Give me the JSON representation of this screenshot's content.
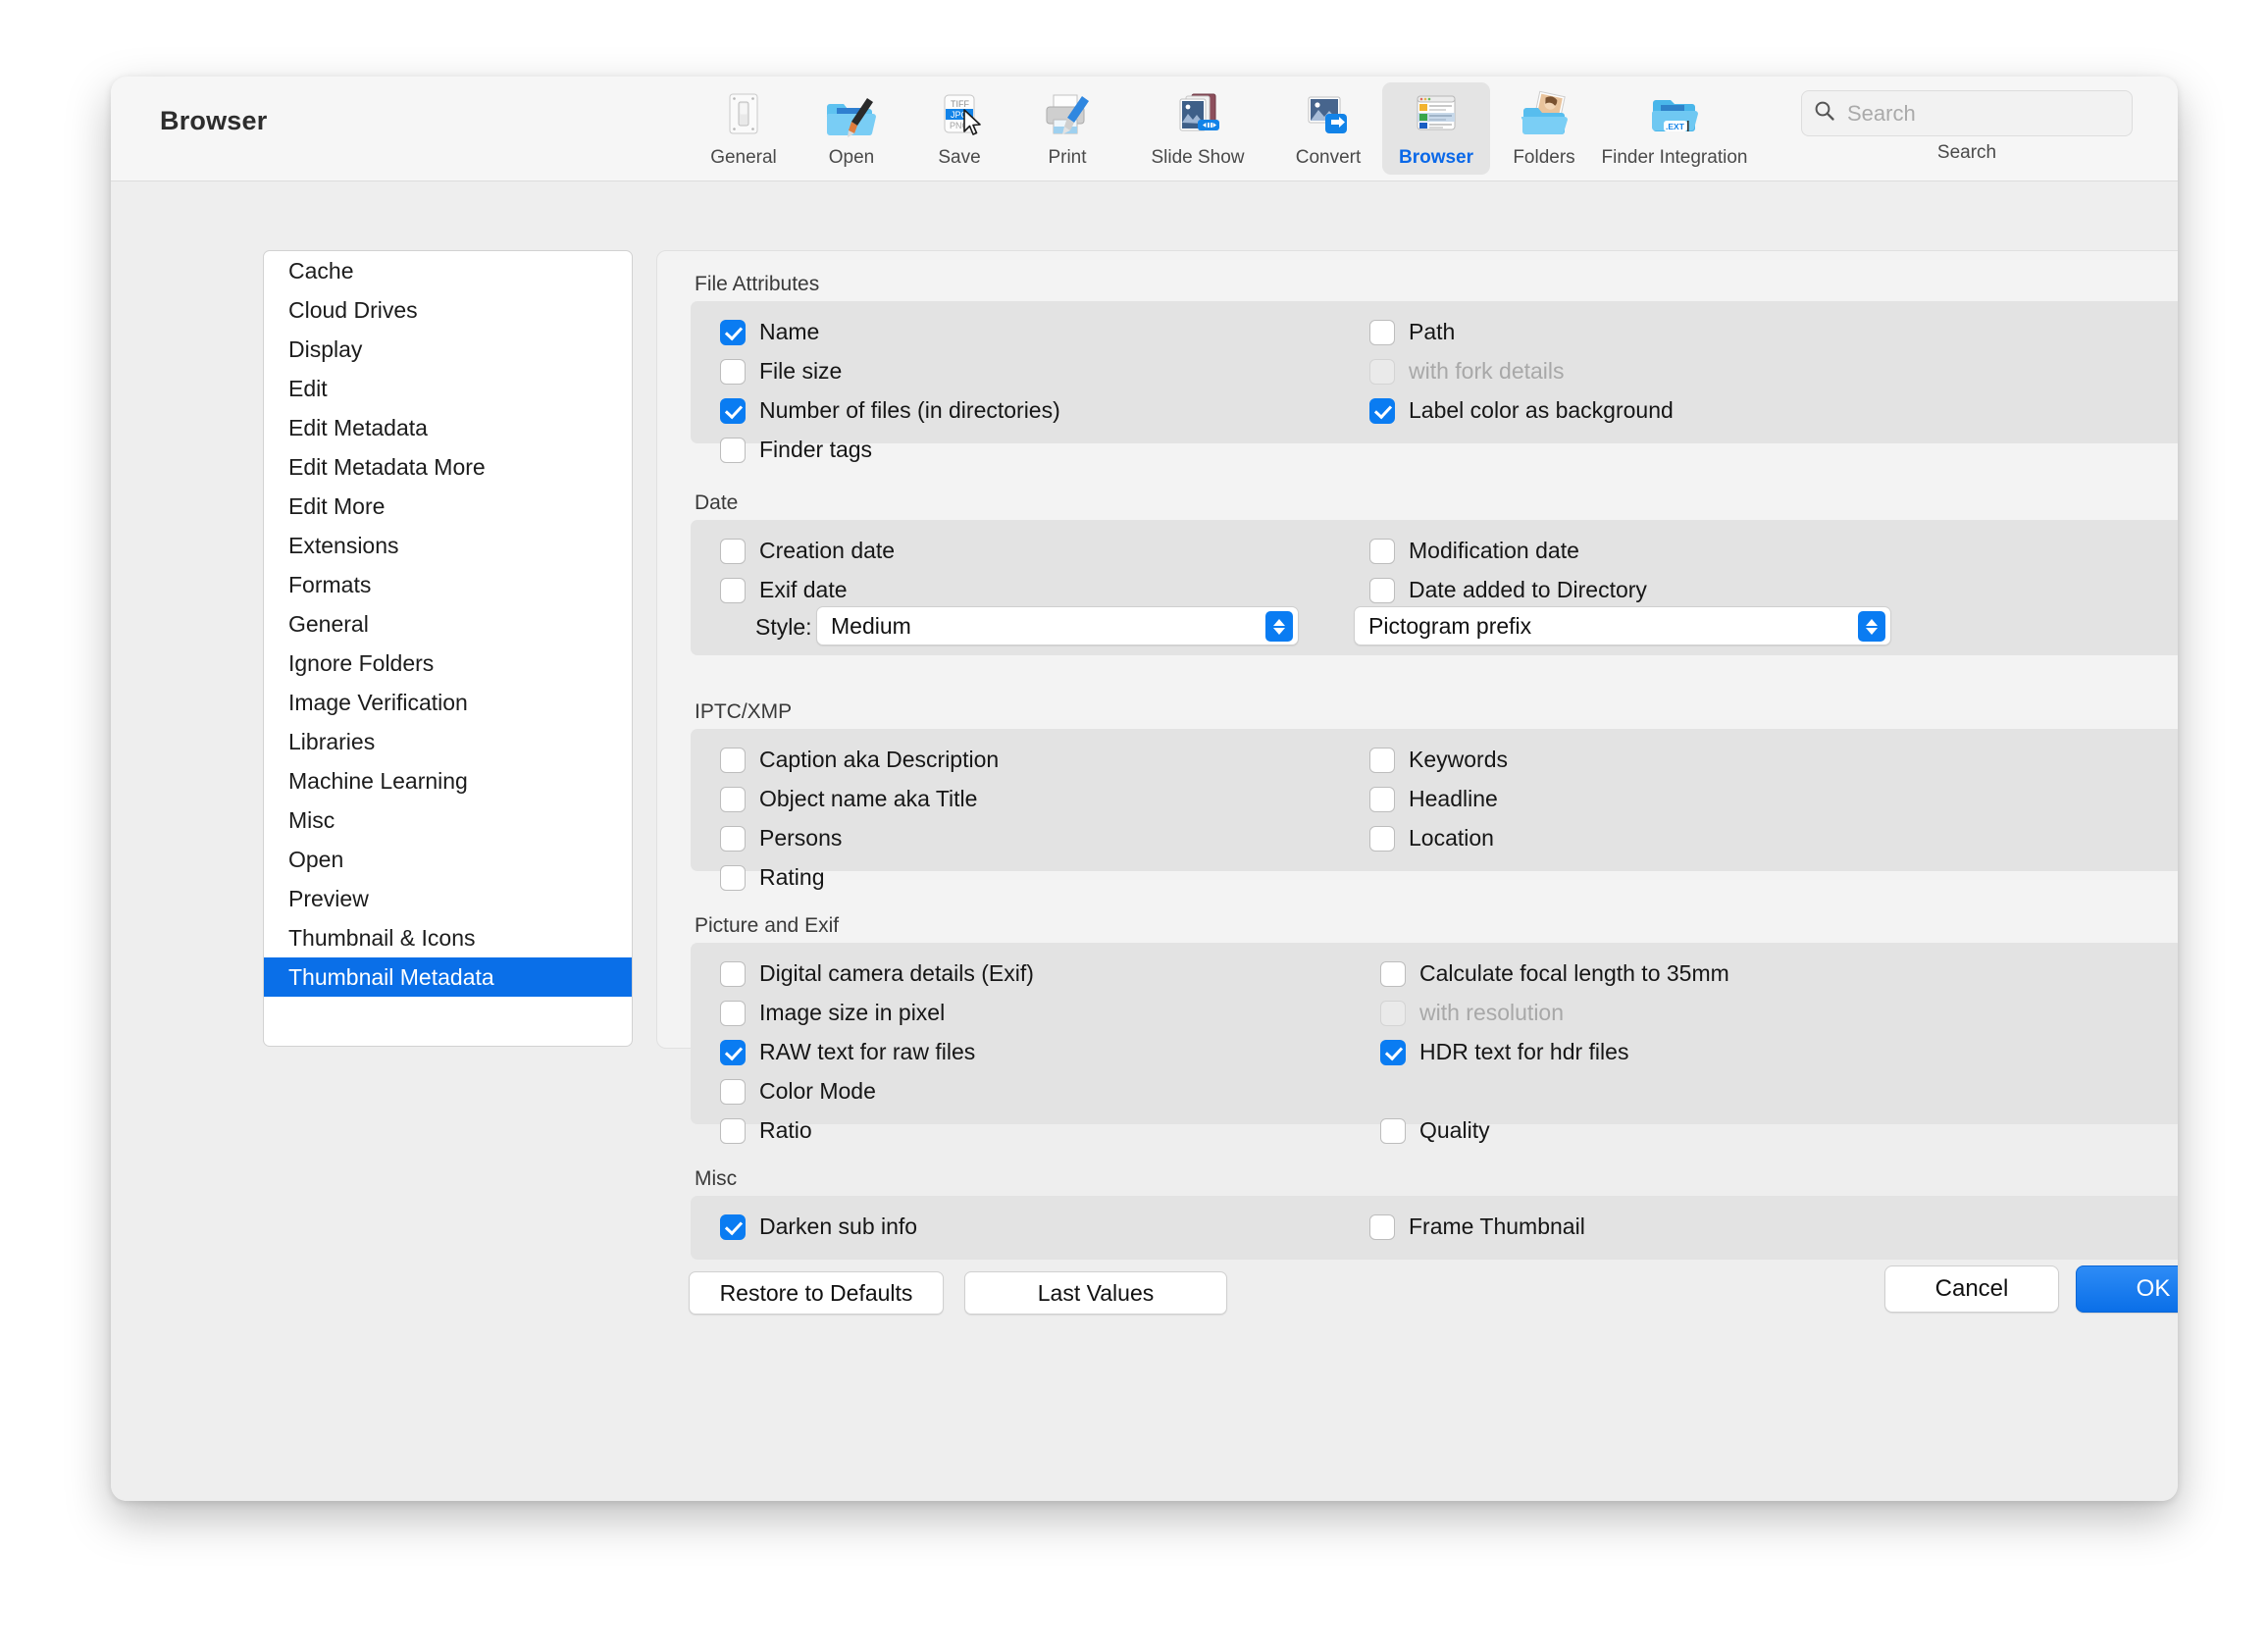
{
  "window": {
    "title": "Browser"
  },
  "toolbar": {
    "items": [
      {
        "label": "General",
        "icon": "switch-icon",
        "selected": false
      },
      {
        "label": "Open",
        "icon": "folder-brush-icon",
        "selected": false
      },
      {
        "label": "Save",
        "icon": "file-formats-icon",
        "selected": false
      },
      {
        "label": "Print",
        "icon": "printer-icon",
        "selected": false
      },
      {
        "label": "Slide Show",
        "icon": "slideshow-icon",
        "selected": false
      },
      {
        "label": "Convert",
        "icon": "convert-icon",
        "selected": false
      },
      {
        "label": "Browser",
        "icon": "browser-window-icon",
        "selected": true
      },
      {
        "label": "Folders",
        "icon": "photo-folder-icon",
        "selected": false
      },
      {
        "label": "Finder Integration",
        "icon": "finder-ext-icon",
        "selected": false
      }
    ],
    "save_icon_labels": [
      "TIFF",
      "JPG",
      "PNG"
    ],
    "finder_ext_badge": ".EXT"
  },
  "search": {
    "placeholder": "Search",
    "value": "",
    "caption": "Search",
    "icon": "search-icon"
  },
  "sidebar": {
    "items": [
      {
        "label": "Cache",
        "active": false
      },
      {
        "label": "Cloud Drives",
        "active": false
      },
      {
        "label": "Display",
        "active": false
      },
      {
        "label": "Edit",
        "active": false
      },
      {
        "label": "Edit Metadata",
        "active": false
      },
      {
        "label": "Edit Metadata More",
        "active": false
      },
      {
        "label": "Edit More",
        "active": false
      },
      {
        "label": "Extensions",
        "active": false
      },
      {
        "label": "Formats",
        "active": false
      },
      {
        "label": "General",
        "active": false
      },
      {
        "label": "Ignore Folders",
        "active": false
      },
      {
        "label": "Image Verification",
        "active": false
      },
      {
        "label": "Libraries",
        "active": false
      },
      {
        "label": "Machine Learning",
        "active": false
      },
      {
        "label": "Misc",
        "active": false
      },
      {
        "label": "Open",
        "active": false
      },
      {
        "label": "Preview",
        "active": false
      },
      {
        "label": "Thumbnail & Icons",
        "active": false
      },
      {
        "label": "Thumbnail Metadata",
        "active": true
      }
    ]
  },
  "groups": {
    "file_attributes": {
      "title": "File Attributes",
      "left": [
        {
          "label": "Name",
          "checked": true,
          "disabled": false
        },
        {
          "label": "File size",
          "checked": false,
          "disabled": false
        },
        {
          "label": "Number of files (in directories)",
          "checked": true,
          "disabled": false
        },
        {
          "label": "Finder tags",
          "checked": false,
          "disabled": false
        }
      ],
      "right": [
        {
          "label": "Path",
          "checked": false,
          "disabled": false
        },
        {
          "label": "with fork details",
          "checked": false,
          "disabled": true
        },
        {
          "label": "Label color as background",
          "checked": true,
          "disabled": false
        }
      ]
    },
    "date": {
      "title": "Date",
      "left": [
        {
          "label": "Creation date",
          "checked": false,
          "disabled": false
        },
        {
          "label": "Exif date",
          "checked": false,
          "disabled": false
        }
      ],
      "right": [
        {
          "label": "Modification date",
          "checked": false,
          "disabled": false
        },
        {
          "label": "Date added to Directory",
          "checked": false,
          "disabled": false
        }
      ],
      "style_label": "Style:",
      "style_value": "Medium",
      "prefix_value": "Pictogram prefix"
    },
    "iptc_xmp": {
      "title": "IPTC/XMP",
      "left": [
        {
          "label": "Caption aka Description",
          "checked": false,
          "disabled": false
        },
        {
          "label": "Object name aka Title",
          "checked": false,
          "disabled": false
        },
        {
          "label": "Persons",
          "checked": false,
          "disabled": false
        },
        {
          "label": "Rating",
          "checked": false,
          "disabled": false
        }
      ],
      "right": [
        {
          "label": "Keywords",
          "checked": false,
          "disabled": false
        },
        {
          "label": "Headline",
          "checked": false,
          "disabled": false
        },
        {
          "label": "Location",
          "checked": false,
          "disabled": false
        }
      ]
    },
    "picture_exif": {
      "title": "Picture and Exif",
      "left": [
        {
          "label": "Digital camera details (Exif)",
          "checked": false,
          "disabled": false
        },
        {
          "label": "Image size in pixel",
          "checked": false,
          "disabled": false
        },
        {
          "label": "RAW text for raw files",
          "checked": true,
          "disabled": false
        },
        {
          "label": "Color Mode",
          "checked": false,
          "disabled": false
        },
        {
          "label": "Ratio",
          "checked": false,
          "disabled": false
        }
      ],
      "right": [
        {
          "label": "Calculate focal length to 35mm",
          "checked": false,
          "disabled": false
        },
        {
          "label": "with resolution",
          "checked": false,
          "disabled": true
        },
        {
          "label": "HDR text for hdr files",
          "checked": true,
          "disabled": false
        },
        {
          "label": "Quality",
          "checked": false,
          "disabled": false
        }
      ]
    },
    "misc": {
      "title": "Misc",
      "left": [
        {
          "label": "Darken sub info",
          "checked": true,
          "disabled": false
        }
      ],
      "right": [
        {
          "label": "Frame Thumbnail",
          "checked": false,
          "disabled": false
        }
      ]
    }
  },
  "actions": {
    "restore_defaults": "Restore to Defaults",
    "last_values": "Last Values"
  },
  "footer": {
    "cancel": "Cancel",
    "ok": "OK"
  },
  "colors": {
    "accent": "#0a7cf2",
    "selection": "#0a6fe8",
    "group_bg": "#e3e3e3",
    "panel_bg": "#f3f3f3",
    "window_bg": "#eeeeee"
  }
}
